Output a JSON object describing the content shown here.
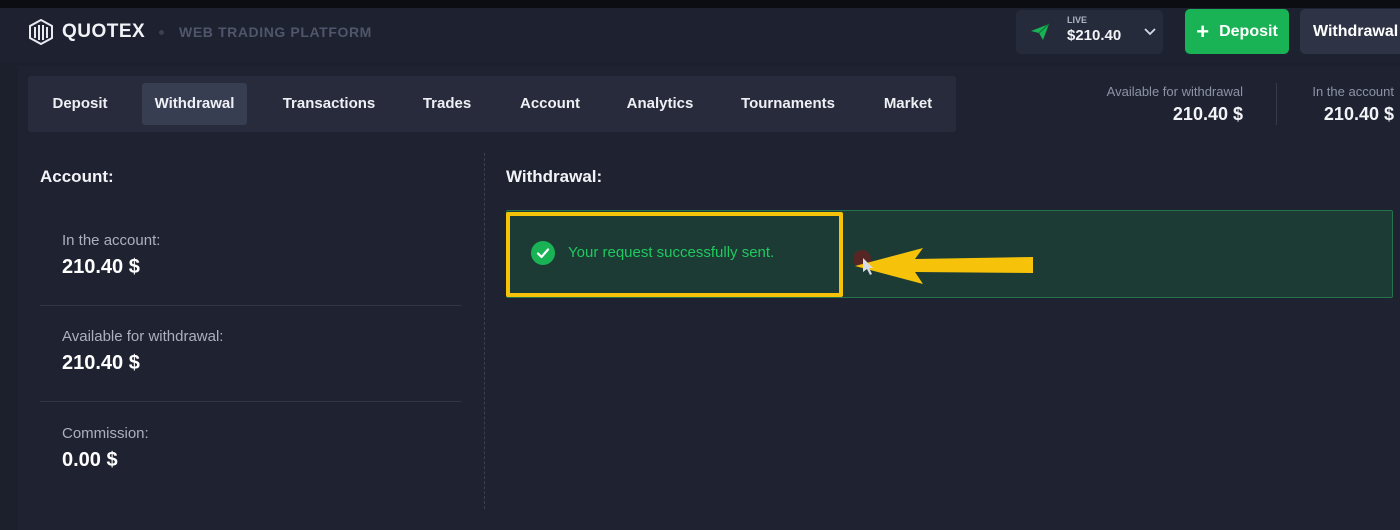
{
  "header": {
    "logo_text": "QUOTEX",
    "platform": "WEB TRADING PLATFORM",
    "live_label": "LIVE",
    "live_amount": "$210.40",
    "deposit_label": "Deposit",
    "withdrawal_label": "Withdrawal"
  },
  "tabs": [
    {
      "label": "Deposit"
    },
    {
      "label": "Withdrawal",
      "active": true
    },
    {
      "label": "Transactions"
    },
    {
      "label": "Trades"
    },
    {
      "label": "Account"
    },
    {
      "label": "Analytics"
    },
    {
      "label": "Tournaments"
    },
    {
      "label": "Market"
    }
  ],
  "summary": {
    "available_label": "Available for withdrawal",
    "available_value": "210.40 $",
    "account_label": "In the account",
    "account_value": "210.40 $"
  },
  "account": {
    "title": "Account:",
    "items": [
      {
        "label": "In the account:",
        "value": "210.40 $"
      },
      {
        "label": "Available for withdrawal:",
        "value": "210.40 $"
      },
      {
        "label": "Commission:",
        "value": "0.00 $"
      }
    ]
  },
  "withdrawal": {
    "title": "Withdrawal:",
    "message": "Your request successfully sent."
  },
  "colors": {
    "accent_green": "#19b356",
    "success_text": "#1ec95f",
    "highlight_yellow": "#f6c30a"
  }
}
